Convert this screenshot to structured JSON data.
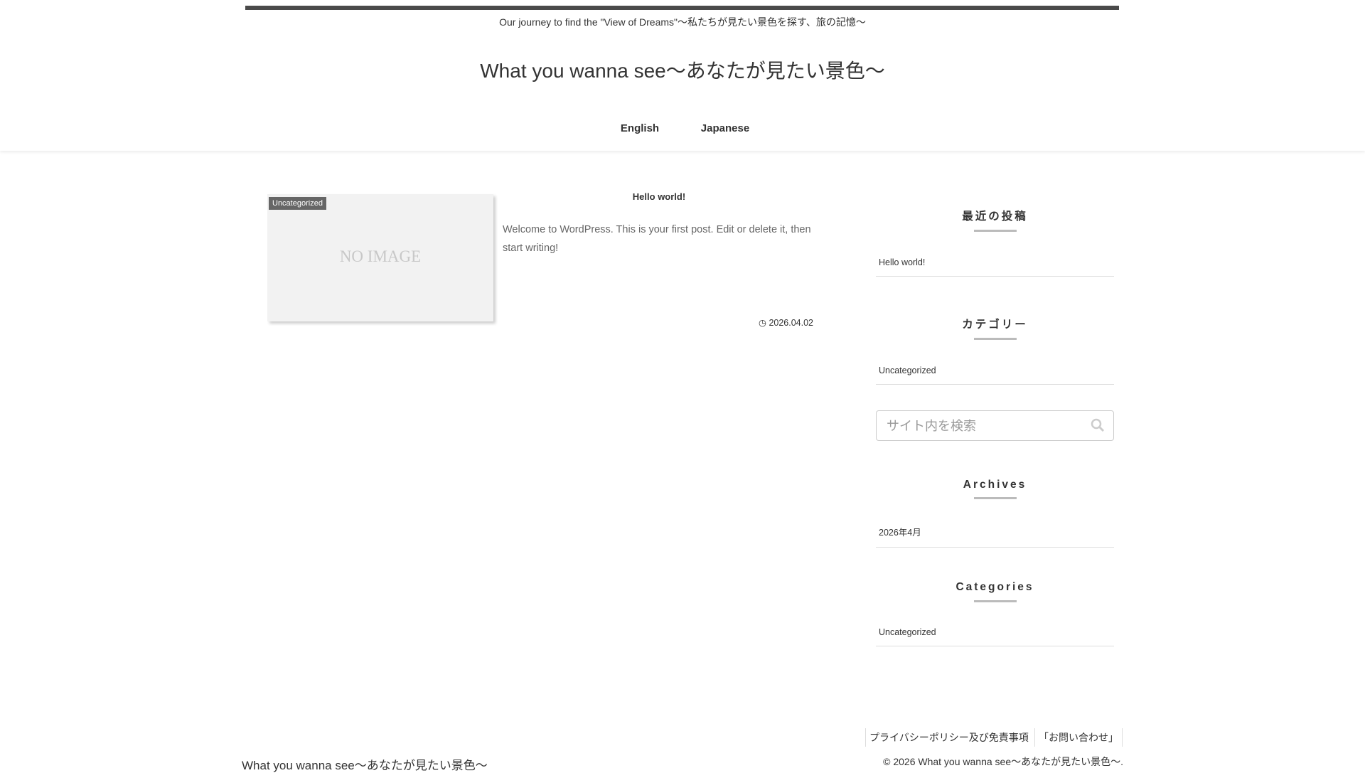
{
  "header": {
    "tagline": "Our journey to find the \"View of Dreams\"〜私たちが見たい景色を探す、旅の記憶〜",
    "site_title": "What you wanna see〜あなたが見たい景色〜",
    "nav": [
      "English",
      "Japanese"
    ]
  },
  "post": {
    "category": "Uncategorized",
    "no_image": "NO IMAGE",
    "title": "Hello world!",
    "excerpt": "Welcome to WordPress. This is your first post. Edit or delete it, then start writing!",
    "date": "2026.04.02"
  },
  "sidebar": {
    "recent_title": "最近の投稿",
    "recent_items": [
      "Hello world!"
    ],
    "category_title": "カテゴリー",
    "category_items": [
      "Uncategorized"
    ],
    "search_placeholder": "サイト内を検索",
    "archives_title": "Archives",
    "archives_items": [
      "2026年4月"
    ],
    "categories_title": "Categories",
    "categories_items": [
      "Uncategorized"
    ]
  },
  "footer": {
    "links": [
      "プライバシーポリシー及び免責事項",
      "「お問い合わせ」"
    ],
    "site_title": "What you wanna see〜あなたが見たい景色〜",
    "copyright": "© 2026 What you wanna see〜あなたが見たい景色〜."
  }
}
